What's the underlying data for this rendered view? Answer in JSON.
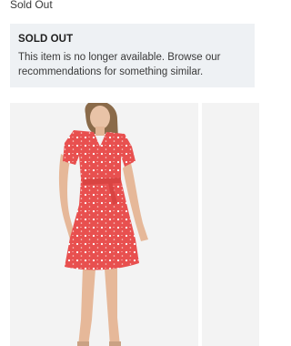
{
  "header": {
    "status_text": "Sold Out"
  },
  "notice": {
    "title": "SOLD OUT",
    "message": "This item is no longer available. Browse our recommendations for something similar."
  },
  "carousel": {
    "items": [
      {
        "image": "product-photo-red-floral-wrap-dress"
      },
      {
        "image": "product-photo-partial"
      }
    ]
  },
  "colors": {
    "notice_background": "#eef1f4",
    "card_background": "#f3f3f3",
    "dress_red": "#e8504f",
    "text": "#393939"
  }
}
